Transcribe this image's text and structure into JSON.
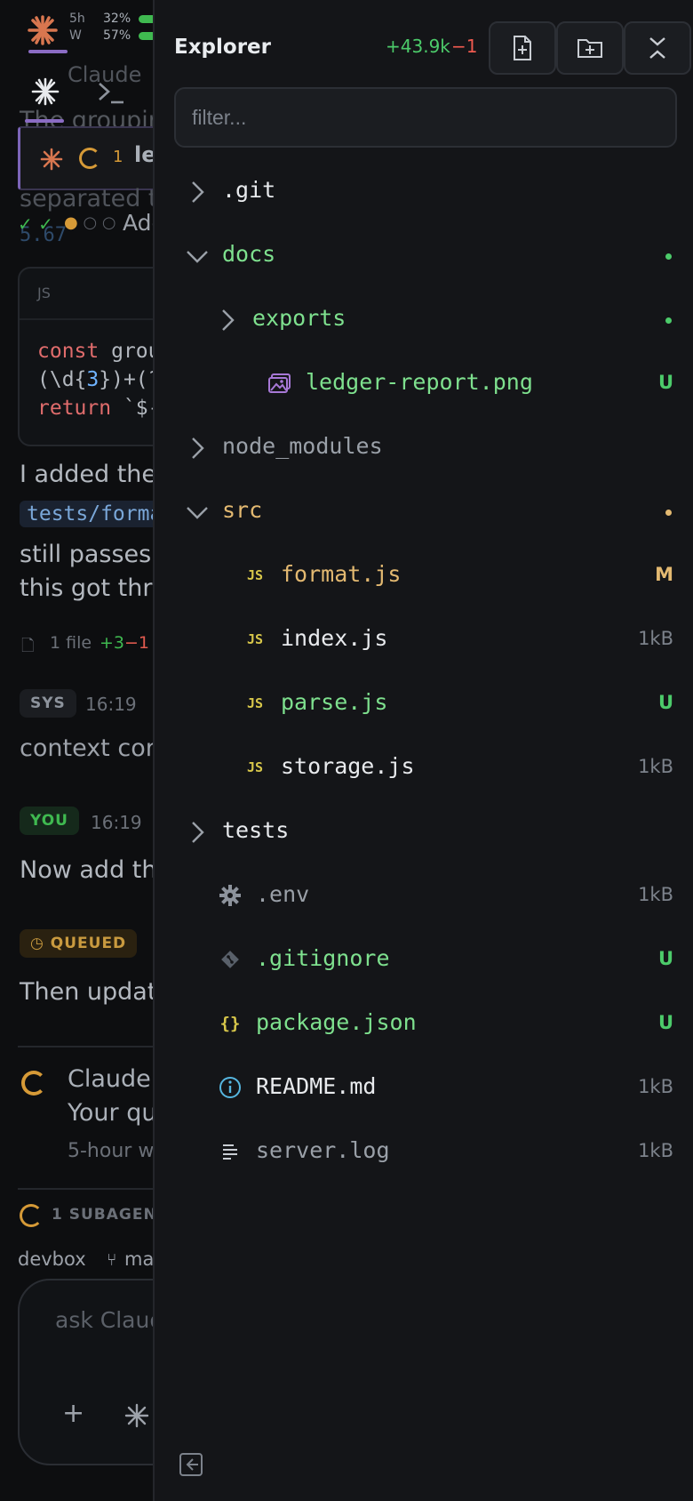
{
  "background": {
    "usage": [
      {
        "label": "5h",
        "percent": "32%"
      },
      {
        "label": "W",
        "percent": "57%"
      }
    ],
    "tab_label_partial": "le",
    "tab_count": "1",
    "top_partial_text": "Claude",
    "heading_partial": "The groupin",
    "separated_partial": "separated th",
    "version_partial": "5.67",
    "progress_label_partial": "Add",
    "code_lang": "JS",
    "code_lines": [
      "const grou",
      "(\\d{3})+(?",
      "return `$-"
    ],
    "text_added": "I added the",
    "test_path": "tests/forma",
    "text_passes": "still passes;",
    "text_through": "this got thro",
    "file_count": "1 file",
    "file_add": "+3",
    "file_del": "−1",
    "sys_badge": "SYS",
    "sys_time": "16:19",
    "sys_text": "context com",
    "you_badge": "YOU",
    "you_time": "16:19",
    "you_text": "Now add the",
    "queued_badge": "QUEUED",
    "queued_text": "Then update",
    "claude_title": "Claude",
    "claude_sub": "Your qu",
    "claude_window": "5-hour w",
    "subagent_label": "1 SUBAGENT",
    "host": "devbox",
    "branch": "ma",
    "composer_placeholder": "ask Claud"
  },
  "explorer": {
    "title": "Explorer",
    "additions": "+43.9k",
    "deletions": "−1",
    "filter_placeholder": "filter...",
    "tree": [
      {
        "name": ".git",
        "kind": "folder",
        "expanded": false,
        "depth": 0,
        "color": "white",
        "meta": "",
        "dot": ""
      },
      {
        "name": "docs",
        "kind": "folder",
        "expanded": true,
        "depth": 0,
        "color": "green",
        "meta": "",
        "dot": "green"
      },
      {
        "name": "exports",
        "kind": "folder",
        "expanded": false,
        "depth": 1,
        "color": "green",
        "meta": "",
        "dot": "green"
      },
      {
        "name": "ledger-report.png",
        "kind": "image",
        "depth": 2,
        "color": "green",
        "meta": "U",
        "meta_kind": "green"
      },
      {
        "name": "node_modules",
        "kind": "folder",
        "expanded": false,
        "depth": 0,
        "color": "gray",
        "meta": "",
        "dot": ""
      },
      {
        "name": "src",
        "kind": "folder",
        "expanded": true,
        "depth": 0,
        "color": "yellow",
        "meta": "",
        "dot": "yellow"
      },
      {
        "name": "format.js",
        "kind": "js",
        "depth": 1,
        "color": "yellow",
        "meta": "M",
        "meta_kind": "yellow"
      },
      {
        "name": "index.js",
        "kind": "js",
        "depth": 1,
        "color": "white",
        "meta": "1kB",
        "meta_kind": "size"
      },
      {
        "name": "parse.js",
        "kind": "js",
        "depth": 1,
        "color": "green",
        "meta": "U",
        "meta_kind": "green"
      },
      {
        "name": "storage.js",
        "kind": "js",
        "depth": 1,
        "color": "white",
        "meta": "1kB",
        "meta_kind": "size"
      },
      {
        "name": "tests",
        "kind": "folder",
        "expanded": false,
        "depth": 0,
        "color": "white",
        "meta": "",
        "dot": ""
      },
      {
        "name": ".env",
        "kind": "gear",
        "depth": 0,
        "color": "gray",
        "meta": "1kB",
        "meta_kind": "size"
      },
      {
        "name": ".gitignore",
        "kind": "git",
        "depth": 0,
        "color": "green",
        "meta": "U",
        "meta_kind": "green"
      },
      {
        "name": "package.json",
        "kind": "json",
        "depth": 0,
        "color": "green",
        "meta": "U",
        "meta_kind": "green"
      },
      {
        "name": "README.md",
        "kind": "info",
        "depth": 0,
        "color": "white",
        "meta": "1kB",
        "meta_kind": "size"
      },
      {
        "name": "server.log",
        "kind": "log",
        "depth": 0,
        "color": "gray",
        "meta": "1kB",
        "meta_kind": "size"
      }
    ],
    "icons": {
      "new_file": "new-file-icon",
      "new_folder": "new-folder-icon",
      "collapse_all": "collapse-all-icon",
      "collapse_panel": "collapse-panel-icon"
    },
    "colors": {
      "accent_green": "#4ccb6a",
      "accent_red": "#ef5a4f",
      "modified": "#e3b971",
      "js_badge": "#d7c64a",
      "image_icon": "#a778d6",
      "info_icon": "#56b6e0"
    }
  }
}
